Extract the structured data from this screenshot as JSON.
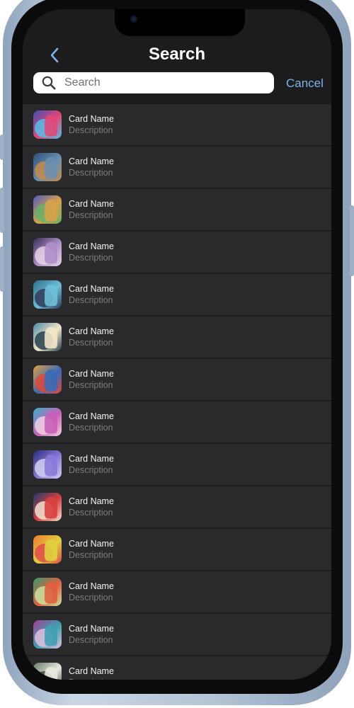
{
  "header": {
    "title": "Search",
    "back_icon": "chevron-left-icon",
    "cancel_label": "Cancel"
  },
  "search": {
    "placeholder": "Search",
    "value": "",
    "icon": "magnifier-icon"
  },
  "colors": {
    "background": "#1c1c1e",
    "row": "#2a2a2c",
    "accent": "#7cb3e8",
    "text": "#f2f2f2",
    "secondary_text": "#7d7d82"
  },
  "cards": [
    {
      "name": "Card Name",
      "description": "Description",
      "art": [
        "#3f4fb0",
        "#e04878",
        "#52c1e8"
      ]
    },
    {
      "name": "Card Name",
      "description": "Description",
      "art": [
        "#2c4f7a",
        "#6a8fb0",
        "#c88a4a"
      ]
    },
    {
      "name": "Card Name",
      "description": "Description",
      "art": [
        "#4b5cc0",
        "#d8a24a",
        "#67b06a"
      ]
    },
    {
      "name": "Card Name",
      "description": "Description",
      "art": [
        "#3b2f55",
        "#b08fc8",
        "#e6d2e8"
      ]
    },
    {
      "name": "Card Name",
      "description": "Description",
      "art": [
        "#2d6f8a",
        "#6fc0d8",
        "#2f3a5a"
      ]
    },
    {
      "name": "Card Name",
      "description": "Description",
      "art": [
        "#4a8aa8",
        "#f2e6c8",
        "#26404e"
      ]
    },
    {
      "name": "Card Name",
      "description": "Description",
      "art": [
        "#e0a040",
        "#3a6ab8",
        "#e04a3a"
      ]
    },
    {
      "name": "Card Name",
      "description": "Description",
      "art": [
        "#3ab0c8",
        "#c860b8",
        "#f0d0e0"
      ]
    },
    {
      "name": "Card Name",
      "description": "Description",
      "art": [
        "#2c2c7a",
        "#8a7ad8",
        "#d0d0f0"
      ]
    },
    {
      "name": "Card Name",
      "description": "Description",
      "art": [
        "#1e3a6a",
        "#d84040",
        "#f0e0d0"
      ]
    },
    {
      "name": "Card Name",
      "description": "Description",
      "art": [
        "#f07a30",
        "#e0d040",
        "#e04a4a"
      ]
    },
    {
      "name": "Card Name",
      "description": "Description",
      "art": [
        "#3a9a6a",
        "#e06040",
        "#c8e0a0"
      ]
    },
    {
      "name": "Card Name",
      "description": "Description",
      "art": [
        "#a04090",
        "#40a0b0",
        "#e0c0e0"
      ]
    },
    {
      "name": "Card Name",
      "description": "Description",
      "art": [
        "#6a7a6a",
        "#e8e8e0",
        "#3a4a3a"
      ]
    }
  ]
}
